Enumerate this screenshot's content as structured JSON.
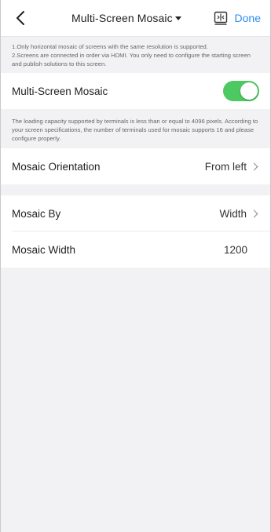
{
  "header": {
    "back_icon": "chevron-left-icon",
    "title": "Multi-Screen Mosaic",
    "action_icon": "screen-split-icon",
    "done_label": "Done",
    "accent_color": "#2f8cf0"
  },
  "notes": {
    "top_line1": "1.Only horizontal mosaic of screens with the same resolution is supported.",
    "top_line2": "2.Screens are connected in order via HDMI. You only need to configure the starting screen and publish solutions to this screen.",
    "capacity": "The loading capacity supported by terminals is less than or equal to 4096 pixels. According to your screen specifications, the number of terminals used for mosaic supports 16 and please configure properly."
  },
  "mosaic_toggle": {
    "label": "Multi-Screen Mosaic",
    "state": "on",
    "on_color": "#4cc960"
  },
  "settings": {
    "orientation": {
      "label": "Mosaic Orientation",
      "value": "From left"
    },
    "mosaic_by": {
      "label": "Mosaic By",
      "value": "Width"
    },
    "mosaic_width": {
      "label": "Mosaic Width",
      "value": "1200"
    }
  }
}
